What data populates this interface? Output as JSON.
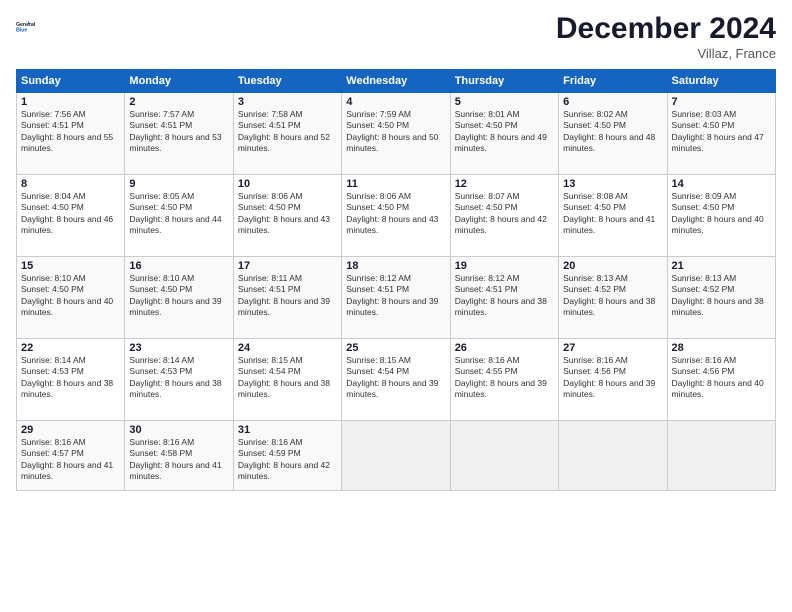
{
  "logo": {
    "line1": "General",
    "line2": "Blue"
  },
  "title": "December 2024",
  "subtitle": "Villaz, France",
  "days_of_week": [
    "Sunday",
    "Monday",
    "Tuesday",
    "Wednesday",
    "Thursday",
    "Friday",
    "Saturday"
  ],
  "weeks": [
    [
      {
        "day": "1",
        "sunrise": "7:56 AM",
        "sunset": "4:51 PM",
        "daylight": "8 hours and 55 minutes."
      },
      {
        "day": "2",
        "sunrise": "7:57 AM",
        "sunset": "4:51 PM",
        "daylight": "8 hours and 53 minutes."
      },
      {
        "day": "3",
        "sunrise": "7:58 AM",
        "sunset": "4:51 PM",
        "daylight": "8 hours and 52 minutes."
      },
      {
        "day": "4",
        "sunrise": "7:59 AM",
        "sunset": "4:50 PM",
        "daylight": "8 hours and 50 minutes."
      },
      {
        "day": "5",
        "sunrise": "8:01 AM",
        "sunset": "4:50 PM",
        "daylight": "8 hours and 49 minutes."
      },
      {
        "day": "6",
        "sunrise": "8:02 AM",
        "sunset": "4:50 PM",
        "daylight": "8 hours and 48 minutes."
      },
      {
        "day": "7",
        "sunrise": "8:03 AM",
        "sunset": "4:50 PM",
        "daylight": "8 hours and 47 minutes."
      }
    ],
    [
      {
        "day": "8",
        "sunrise": "8:04 AM",
        "sunset": "4:50 PM",
        "daylight": "8 hours and 46 minutes."
      },
      {
        "day": "9",
        "sunrise": "8:05 AM",
        "sunset": "4:50 PM",
        "daylight": "8 hours and 44 minutes."
      },
      {
        "day": "10",
        "sunrise": "8:06 AM",
        "sunset": "4:50 PM",
        "daylight": "8 hours and 43 minutes."
      },
      {
        "day": "11",
        "sunrise": "8:06 AM",
        "sunset": "4:50 PM",
        "daylight": "8 hours and 43 minutes."
      },
      {
        "day": "12",
        "sunrise": "8:07 AM",
        "sunset": "4:50 PM",
        "daylight": "8 hours and 42 minutes."
      },
      {
        "day": "13",
        "sunrise": "8:08 AM",
        "sunset": "4:50 PM",
        "daylight": "8 hours and 41 minutes."
      },
      {
        "day": "14",
        "sunrise": "8:09 AM",
        "sunset": "4:50 PM",
        "daylight": "8 hours and 40 minutes."
      }
    ],
    [
      {
        "day": "15",
        "sunrise": "8:10 AM",
        "sunset": "4:50 PM",
        "daylight": "8 hours and 40 minutes."
      },
      {
        "day": "16",
        "sunrise": "8:10 AM",
        "sunset": "4:50 PM",
        "daylight": "8 hours and 39 minutes."
      },
      {
        "day": "17",
        "sunrise": "8:11 AM",
        "sunset": "4:51 PM",
        "daylight": "8 hours and 39 minutes."
      },
      {
        "day": "18",
        "sunrise": "8:12 AM",
        "sunset": "4:51 PM",
        "daylight": "8 hours and 39 minutes."
      },
      {
        "day": "19",
        "sunrise": "8:12 AM",
        "sunset": "4:51 PM",
        "daylight": "8 hours and 38 minutes."
      },
      {
        "day": "20",
        "sunrise": "8:13 AM",
        "sunset": "4:52 PM",
        "daylight": "8 hours and 38 minutes."
      },
      {
        "day": "21",
        "sunrise": "8:13 AM",
        "sunset": "4:52 PM",
        "daylight": "8 hours and 38 minutes."
      }
    ],
    [
      {
        "day": "22",
        "sunrise": "8:14 AM",
        "sunset": "4:53 PM",
        "daylight": "8 hours and 38 minutes."
      },
      {
        "day": "23",
        "sunrise": "8:14 AM",
        "sunset": "4:53 PM",
        "daylight": "8 hours and 38 minutes."
      },
      {
        "day": "24",
        "sunrise": "8:15 AM",
        "sunset": "4:54 PM",
        "daylight": "8 hours and 38 minutes."
      },
      {
        "day": "25",
        "sunrise": "8:15 AM",
        "sunset": "4:54 PM",
        "daylight": "8 hours and 39 minutes."
      },
      {
        "day": "26",
        "sunrise": "8:16 AM",
        "sunset": "4:55 PM",
        "daylight": "8 hours and 39 minutes."
      },
      {
        "day": "27",
        "sunrise": "8:16 AM",
        "sunset": "4:56 PM",
        "daylight": "8 hours and 39 minutes."
      },
      {
        "day": "28",
        "sunrise": "8:16 AM",
        "sunset": "4:56 PM",
        "daylight": "8 hours and 40 minutes."
      }
    ],
    [
      {
        "day": "29",
        "sunrise": "8:16 AM",
        "sunset": "4:57 PM",
        "daylight": "8 hours and 41 minutes."
      },
      {
        "day": "30",
        "sunrise": "8:16 AM",
        "sunset": "4:58 PM",
        "daylight": "8 hours and 41 minutes."
      },
      {
        "day": "31",
        "sunrise": "8:16 AM",
        "sunset": "4:59 PM",
        "daylight": "8 hours and 42 minutes."
      },
      null,
      null,
      null,
      null
    ]
  ]
}
